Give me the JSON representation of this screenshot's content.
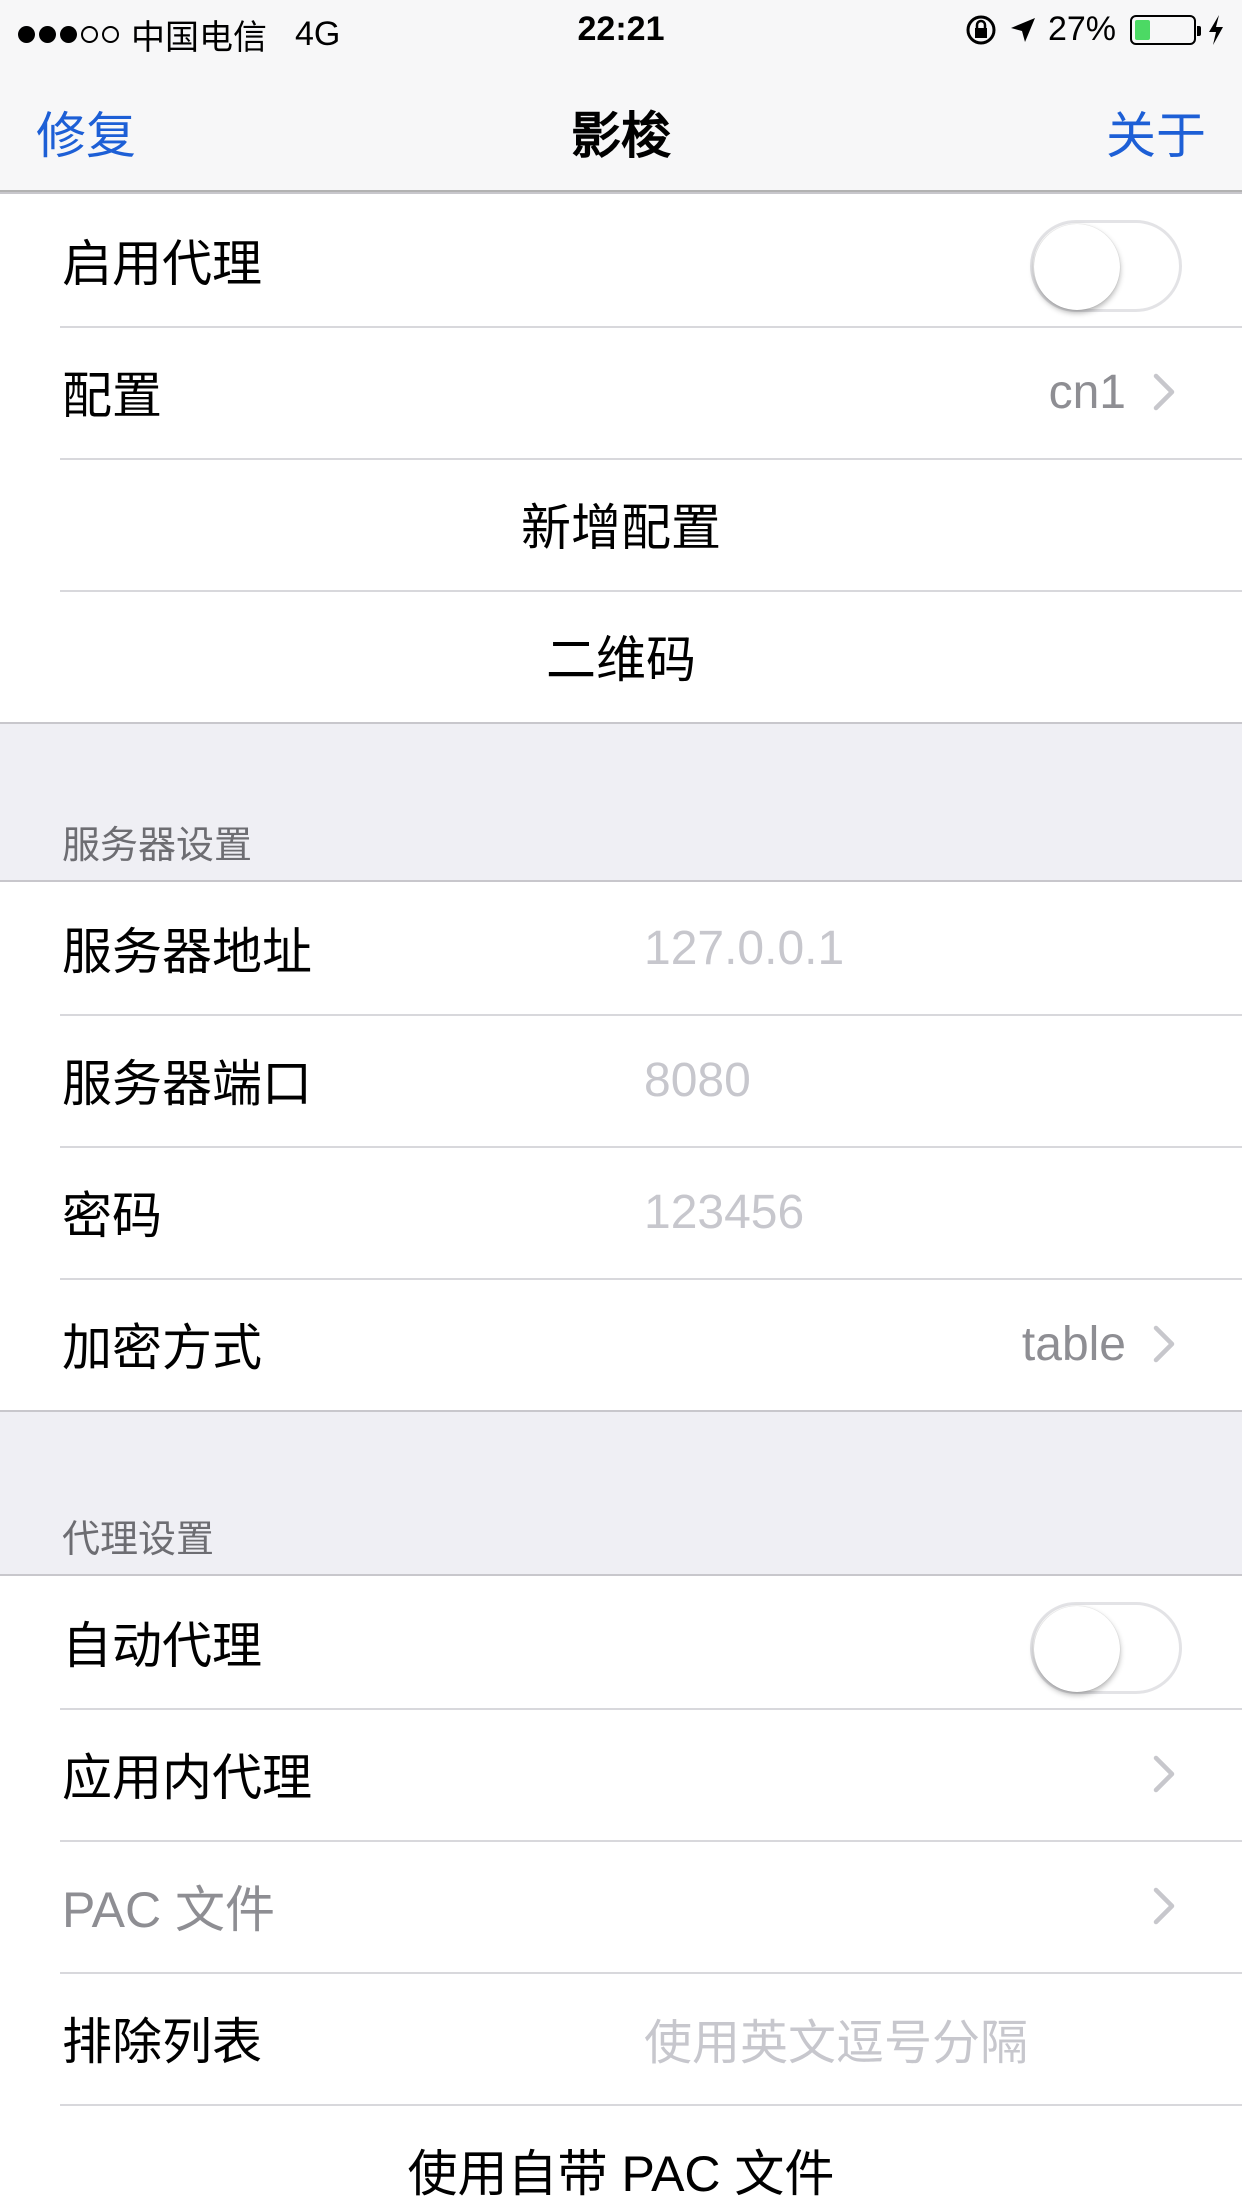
{
  "status_bar": {
    "carrier": "中国电信",
    "network": "4G",
    "time": "22:21",
    "battery_percent": "27%",
    "battery_level": 0.27,
    "battery_color": "#4cd964",
    "signal_filled": 3,
    "signal_total": 5,
    "icons": [
      "orientation-lock-icon",
      "location-arrow-icon",
      "charging-bolt-icon"
    ]
  },
  "nav": {
    "left": "修复",
    "title": "影梭",
    "right": "关于",
    "tint_color": "#1d5fd6"
  },
  "section1": {
    "enable_proxy": {
      "label": "启用代理",
      "on": false
    },
    "config": {
      "label": "配置",
      "value": "cn1"
    },
    "add_config": "新增配置",
    "qrcode": "二维码"
  },
  "server": {
    "header": "服务器设置",
    "address": {
      "label": "服务器地址",
      "placeholder": "127.0.0.1"
    },
    "port": {
      "label": "服务器端口",
      "placeholder": "8080"
    },
    "password": {
      "label": "密码",
      "placeholder": "123456"
    },
    "encryption": {
      "label": "加密方式",
      "value": "table"
    }
  },
  "proxy": {
    "header": "代理设置",
    "auto_proxy": {
      "label": "自动代理",
      "on": false
    },
    "in_app_proxy": {
      "label": "应用内代理"
    },
    "pac_file": {
      "label": "PAC 文件"
    },
    "exclude_list": {
      "label": "排除列表",
      "placeholder": "使用英文逗号分隔"
    },
    "use_builtin_pac": "使用自带 PAC 文件"
  }
}
